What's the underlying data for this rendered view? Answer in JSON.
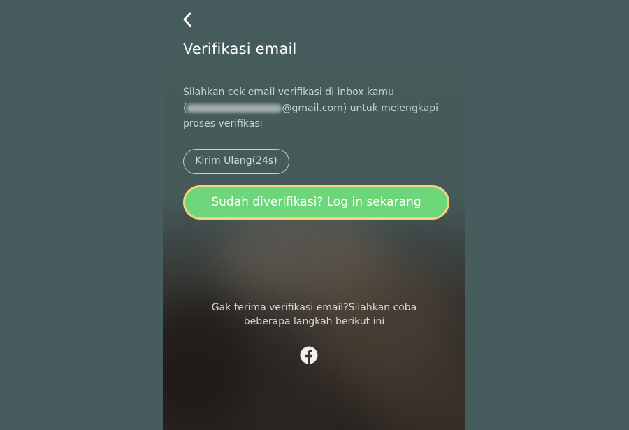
{
  "screen": {
    "title": "Verifikasi email",
    "description": {
      "line1": "Silahkan cek email verifikasi di inbox kamu",
      "email_prefix": "(",
      "email_suffix": "@gmail.com) untuk melengkapi",
      "line3": "proses verifikasi"
    },
    "resend_button": "Kirim Ulang(24s)",
    "login_button": "Sudah diverifikasi? Log in sekarang",
    "help": {
      "line1": "Gak terima verifikasi email?Silahkan coba",
      "line2": "beberapa langkah berikut ini"
    },
    "icons": {
      "back": "chevron-left-icon",
      "help": "facebook-icon"
    }
  },
  "colors": {
    "background": "#475c5c",
    "primary_button": "#6dd57a",
    "highlight_border": "#f4d17f",
    "text_light": "#ffffff"
  }
}
